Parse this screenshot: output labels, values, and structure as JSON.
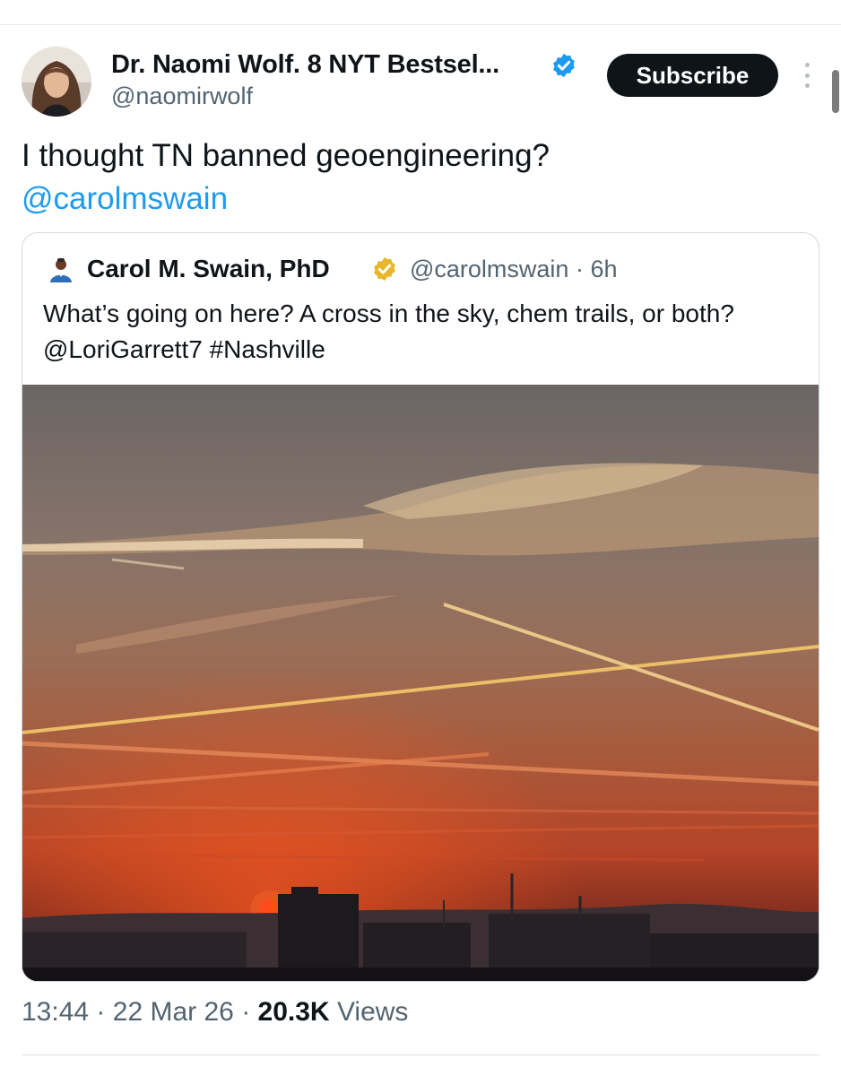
{
  "author": {
    "name": "Dr. Naomi Wolf. 8 NYT Bestsel...",
    "handle": "@naomirwolf",
    "avatar_icon": "avatar-photo"
  },
  "subscribe_label": "Subscribe",
  "tweet": {
    "text": "I thought TN banned geoengineering?",
    "mention": "@carolmswain"
  },
  "quote": {
    "name": "Carol M. Swain, PhD",
    "handle": "@carolmswain",
    "separator": "·",
    "time": "6h",
    "text": "What’s going on here? A cross in the sky, chem trails, or both? @LoriGarrett7 #Nashville",
    "photo_icon": "sunset-contrails-photo"
  },
  "meta": {
    "time": "13:44",
    "separator": "·",
    "date": "22 Mar 26",
    "views_count": "20.3K",
    "views_label": "Views"
  },
  "colors": {
    "accent": "#1d9bf0",
    "verified_blue": "#1d9bf0",
    "verified_gold": "#e8b829",
    "subscribe_bg": "#0f1419",
    "secondary_text": "#536471"
  }
}
